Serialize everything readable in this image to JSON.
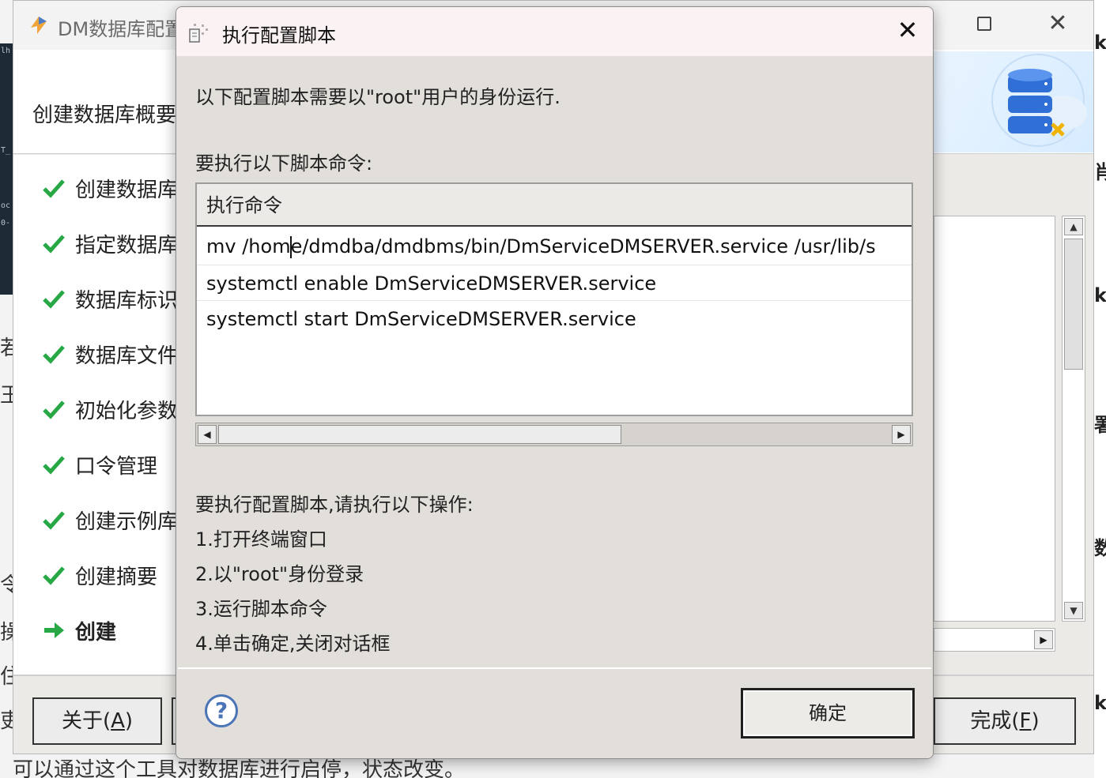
{
  "main_window": {
    "title": "DM数据库配置",
    "header_title": "创建数据库概要",
    "steps": [
      {
        "label": "创建数据库",
        "state": "done"
      },
      {
        "label": "指定数据库",
        "state": "done"
      },
      {
        "label": "数据库标识",
        "state": "done"
      },
      {
        "label": "数据库文件",
        "state": "done"
      },
      {
        "label": "初始化参数",
        "state": "done"
      },
      {
        "label": "口令管理",
        "state": "done"
      },
      {
        "label": "创建示例库",
        "state": "done"
      },
      {
        "label": "创建摘要",
        "state": "done"
      },
      {
        "label": "创建",
        "state": "current"
      }
    ],
    "buttons": {
      "about_label": "关于(",
      "about_mnemonic": "A",
      "about_tail": ")",
      "finish_label": "完成(",
      "finish_mnemonic": "F",
      "finish_tail": ")"
    }
  },
  "dialog": {
    "title": "执行配置脚本",
    "intro": "以下配置脚本需要以\"root\"用户的身份运行.",
    "commands_caption": "要执行以下脚本命令:",
    "table_header": "执行命令",
    "commands": [
      "mv /home/dmdba/dmdbms/bin/DmServiceDMSERVER.service /usr/lib/s",
      "systemctl enable DmServiceDMSERVER.service",
      "systemctl start DmServiceDMSERVER.service"
    ],
    "instructions_title": "要执行配置脚本,请执行以下操作:",
    "instructions": [
      "1.打开终端窗口",
      "2.以\"root\"身份登录",
      "3.运行脚本命令",
      "4.单击确定,关闭对话框"
    ],
    "ok_label": "确定"
  },
  "background": {
    "bottom_text": "可以通过这个工具对数据库进行启停，状态改变。"
  },
  "colors": {
    "check_green": "#27a845",
    "arrow_green": "#27a845",
    "help_blue": "#4a74b5"
  }
}
